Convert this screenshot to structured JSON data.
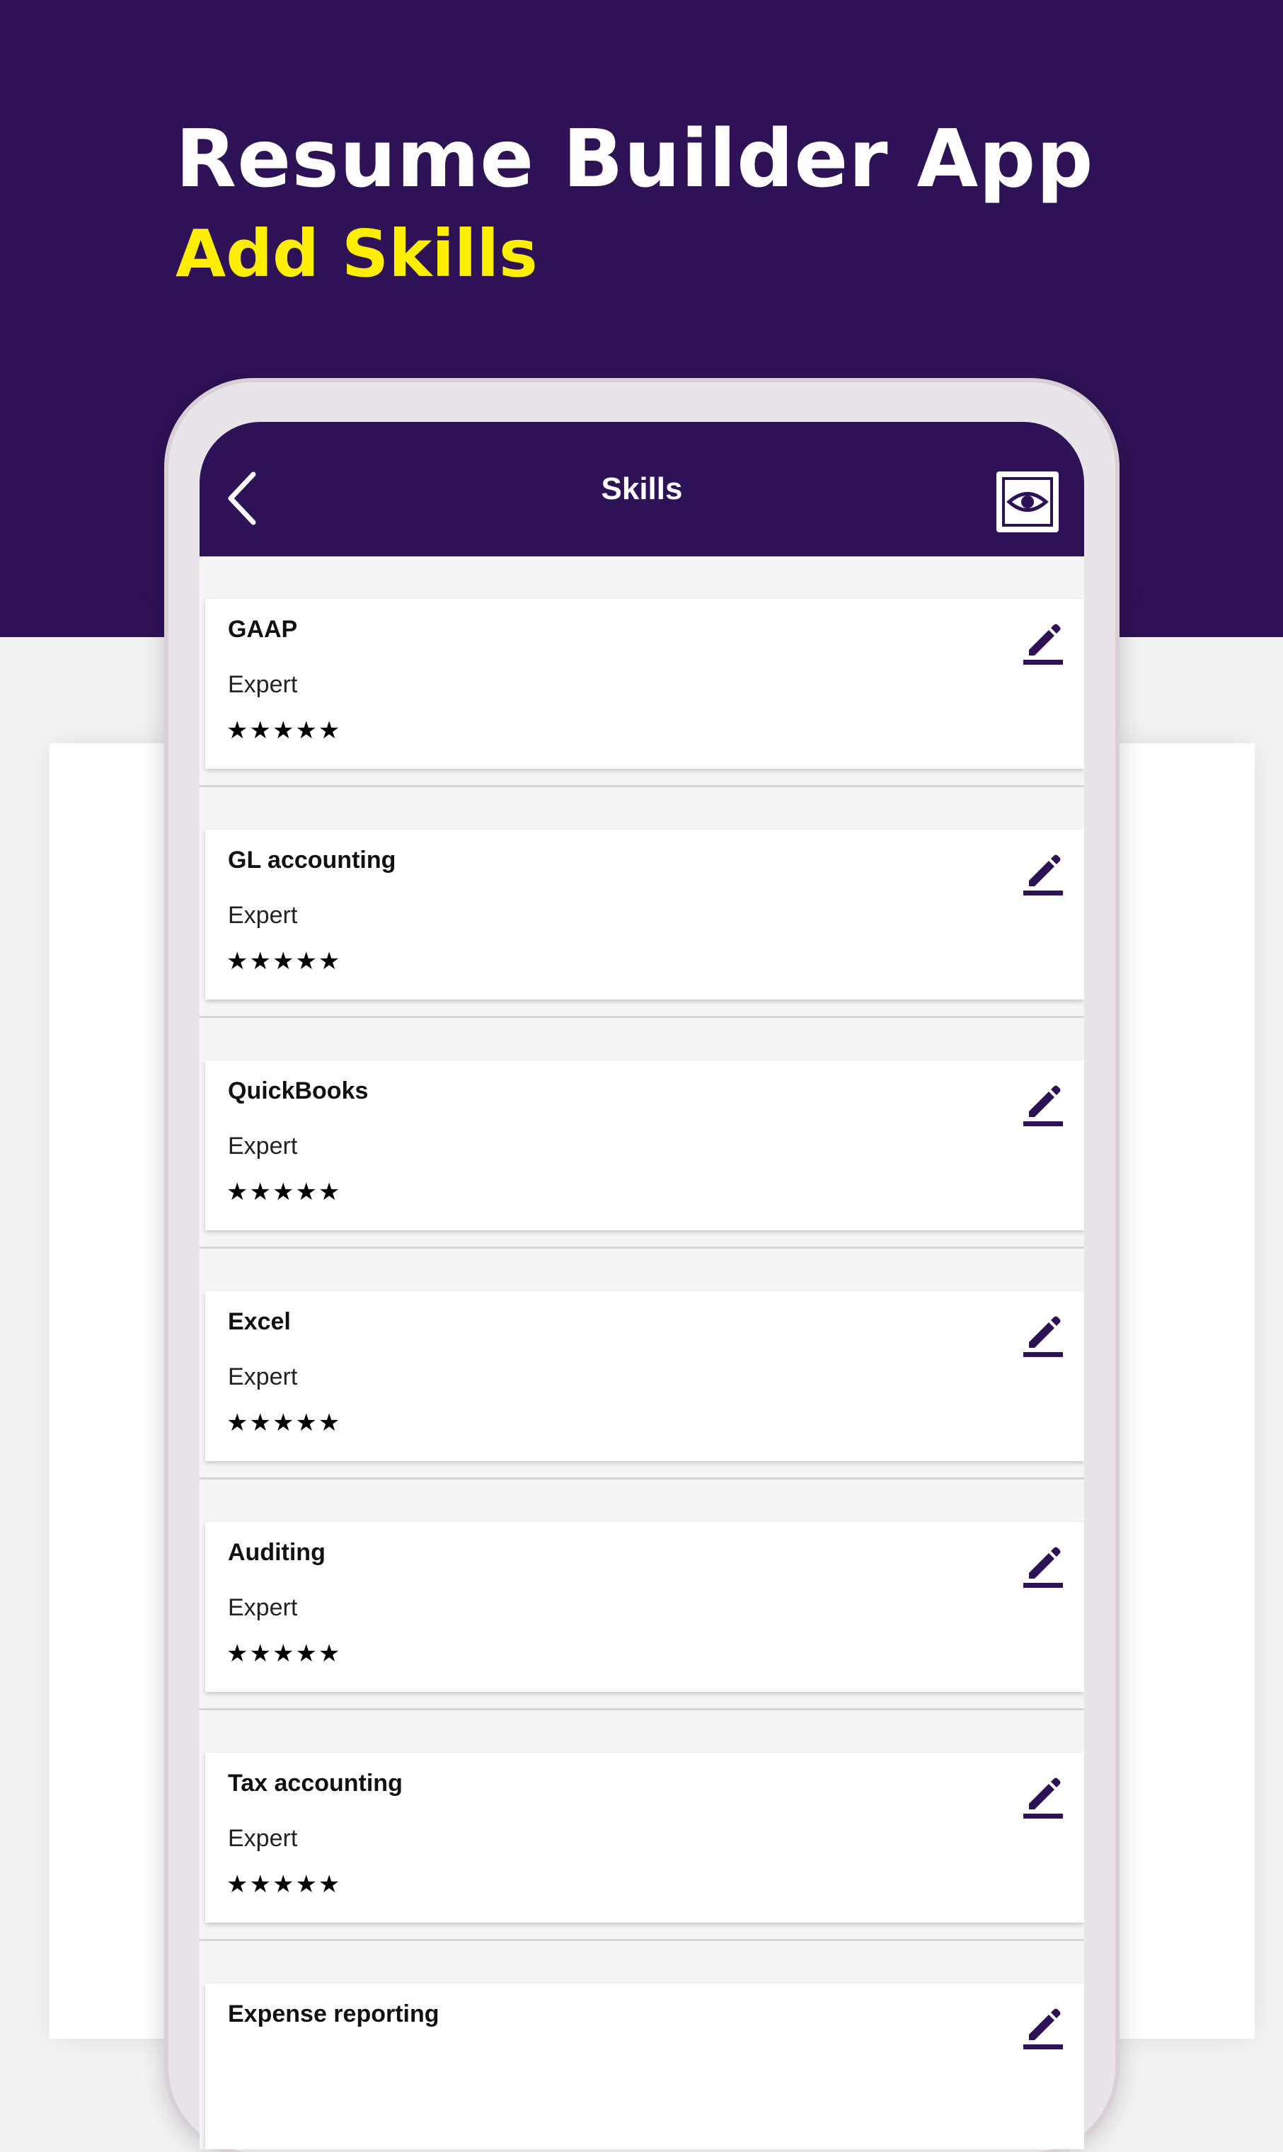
{
  "promo": {
    "title": "Resume Builder App",
    "subtitle": "Add Skills"
  },
  "colors": {
    "brand": "#2e1256",
    "accent": "#ffee00"
  },
  "appbar": {
    "title": "Skills",
    "back_icon": "chevron-left-icon",
    "preview_icon": "eye-icon"
  },
  "skills": [
    {
      "name": "GAAP",
      "level": "Expert",
      "rating": "★★★★★"
    },
    {
      "name": "GL accounting",
      "level": "Expert",
      "rating": "★★★★★"
    },
    {
      "name": "QuickBooks",
      "level": "Expert",
      "rating": "★★★★★"
    },
    {
      "name": "Excel",
      "level": "Expert",
      "rating": "★★★★★"
    },
    {
      "name": "Auditing",
      "level": "Expert",
      "rating": "★★★★★"
    },
    {
      "name": "Tax accounting",
      "level": "Expert",
      "rating": "★★★★★"
    },
    {
      "name": "Expense reporting",
      "level": "",
      "rating": ""
    }
  ]
}
